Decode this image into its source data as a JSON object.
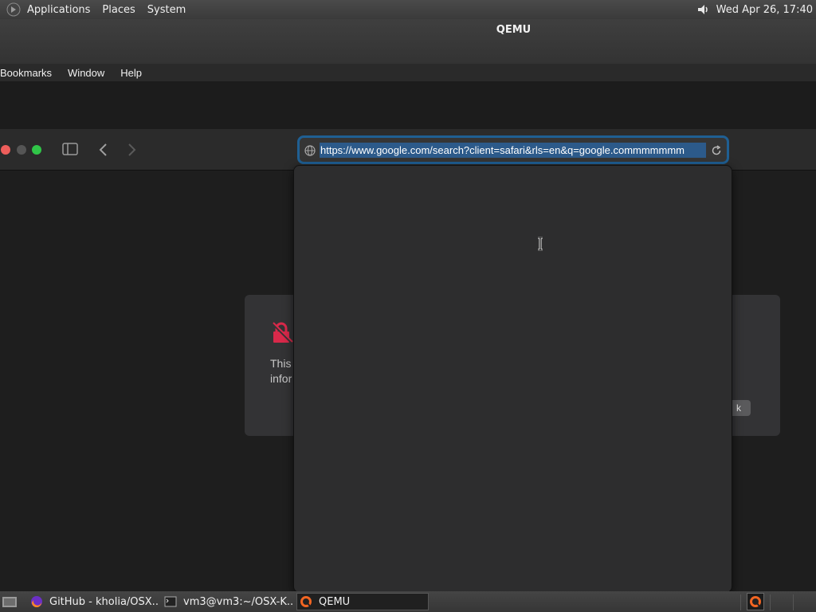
{
  "gnome_panel": {
    "menus": [
      "Applications",
      "Places",
      "System"
    ],
    "clock": "Wed Apr 26, 17:40",
    "icons": {
      "logo": "gnome-foot-icon",
      "volume": "speaker-icon"
    }
  },
  "qemu_window": {
    "title": "QEMU"
  },
  "mac_menubar": {
    "items": [
      "Bookmarks",
      "Window",
      "Help"
    ]
  },
  "safari": {
    "address_bar": {
      "url": "https://www.google.com/search?client=safari&rls=en&q=google.commmmmmm",
      "selected": true
    }
  },
  "warning_page": {
    "text_line1": "This",
    "text_line2": "infor",
    "button_label": "k"
  },
  "taskbar": {
    "tasks": [
      {
        "label": "GitHub - kholia/OSX...",
        "icon": "firefox-icon"
      },
      {
        "label": "vm3@vm3:~/OSX-K...",
        "icon": "terminal-icon"
      },
      {
        "label": "QEMU",
        "icon": "qemu-icon",
        "active": true
      }
    ]
  },
  "colors": {
    "close": "#ee5e5b",
    "maximize": "#30c548",
    "url_focus": "#1f5f93",
    "selection": "#2c5a8a",
    "warning": "#d8294a"
  }
}
